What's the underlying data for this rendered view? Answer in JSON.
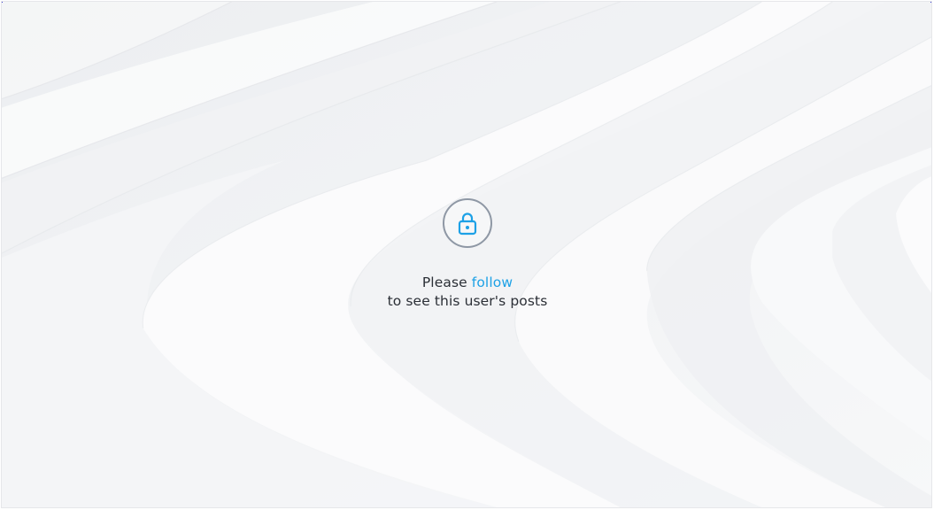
{
  "locked_state": {
    "lock_icon": "lock-icon",
    "prefix": "Please",
    "link_label": "follow",
    "suffix": "to see this user's posts"
  },
  "colors": {
    "accent": "#1da1e6",
    "lock_ring": "#8f98a5",
    "text": "#2b2f36",
    "background": "#f3f4f6"
  }
}
